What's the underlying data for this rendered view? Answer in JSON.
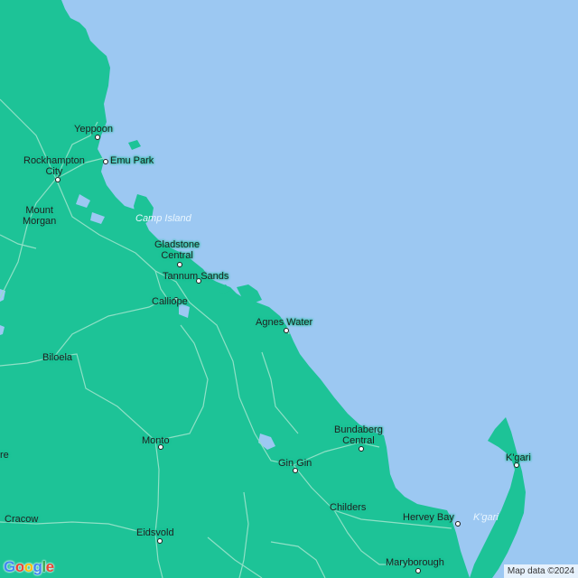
{
  "map": {
    "colors": {
      "land": "#1dc397",
      "water": "#9cc8f2",
      "road": "#8fe0c6",
      "label": "#1f1f1f"
    },
    "places": [
      {
        "id": "yeppoon",
        "name": "Yeppoon"
      },
      {
        "id": "rockhampton",
        "name": "Rockhampton\nCity"
      },
      {
        "id": "emu-park",
        "name": "Emu Park"
      },
      {
        "id": "mount-morgan",
        "name": "Mount\nMorgan"
      },
      {
        "id": "camp-island",
        "name": "Camp Island"
      },
      {
        "id": "gladstone",
        "name": "Gladstone\nCentral"
      },
      {
        "id": "tannum-sands",
        "name": "Tannum Sands"
      },
      {
        "id": "calliope",
        "name": "Calliope"
      },
      {
        "id": "agnes-water",
        "name": "Agnes Water"
      },
      {
        "id": "biloela",
        "name": "Biloela"
      },
      {
        "id": "bundaberg",
        "name": "Bundaberg\nCentral"
      },
      {
        "id": "kgari-town",
        "name": "K'gari"
      },
      {
        "id": "monto",
        "name": "Monto"
      },
      {
        "id": "gin-gin",
        "name": "Gin Gin"
      },
      {
        "id": "childers",
        "name": "Childers"
      },
      {
        "id": "hervey-bay",
        "name": "Hervey Bay"
      },
      {
        "id": "kgari-island",
        "name": "K'gari"
      },
      {
        "id": "cracow",
        "name": "Cracow"
      },
      {
        "id": "eidsvold",
        "name": "Eidsvold"
      },
      {
        "id": "maryborough",
        "name": "Maryborough"
      },
      {
        "id": "edge-re",
        "name": "re"
      }
    ],
    "logo": "Google",
    "attribution": "Map data ©2024"
  }
}
